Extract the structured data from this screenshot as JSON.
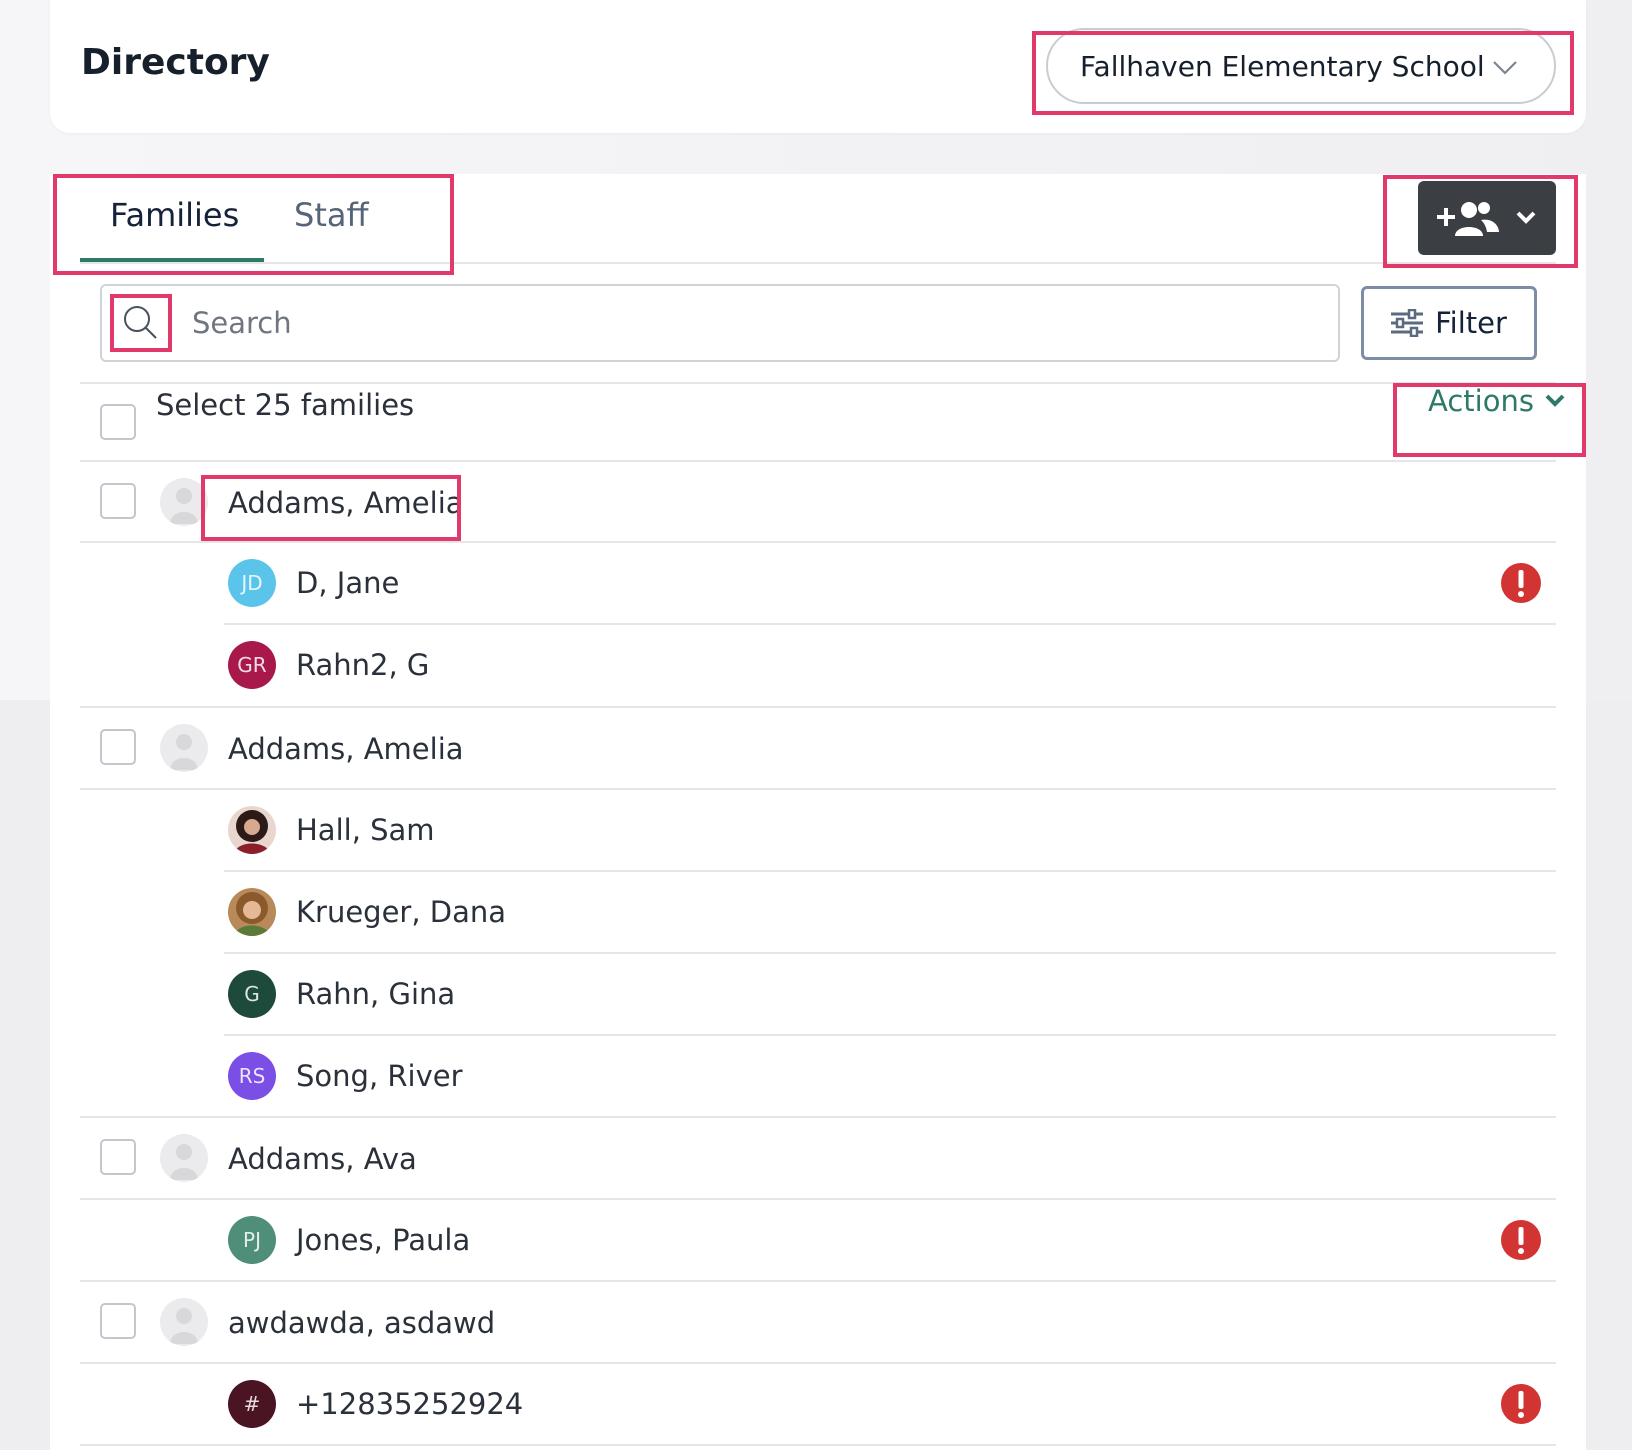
{
  "header": {
    "title": "Directory",
    "school_select": "Fallhaven Elementary School"
  },
  "tabs": [
    {
      "label": "Families",
      "active": true
    },
    {
      "label": "Staff",
      "active": false
    }
  ],
  "search": {
    "placeholder": "Search",
    "value": ""
  },
  "filter_label": "Filter",
  "select_all_label": "Select 25 families",
  "actions_label": "Actions",
  "colors": {
    "accent": "#2e7a68",
    "highlight": "#e0396a",
    "alert": "#d23434",
    "dark_button": "#3b3e42"
  },
  "families": [
    {
      "name": "Addams, Amelia",
      "members": [
        {
          "name": "D, Jane",
          "initials": "JD",
          "color": "#5bc4ea",
          "alert": true
        },
        {
          "name": "Rahn2, G",
          "initials": "GR",
          "color": "#a8184b",
          "alert": false
        }
      ]
    },
    {
      "name": "Addams, Amelia",
      "members": [
        {
          "name": "Hall, Sam",
          "initials": "",
          "color": "#6a3b35",
          "photo": true,
          "alert": false
        },
        {
          "name": "Krueger, Dana",
          "initials": "",
          "color": "#9b6b3a",
          "photo": true,
          "alert": false
        },
        {
          "name": "Rahn, Gina",
          "initials": "G",
          "color": "#1e4a3c",
          "alert": false
        },
        {
          "name": "Song, River",
          "initials": "RS",
          "color": "#7b4fe6",
          "alert": false
        }
      ]
    },
    {
      "name": "Addams, Ava",
      "members": [
        {
          "name": "Jones, Paula",
          "initials": "PJ",
          "color": "#4f8e78",
          "alert": true
        }
      ]
    },
    {
      "name": "awdawda, asdawd",
      "members": [
        {
          "name": "+12835252924",
          "initials": "#",
          "color": "#4a1423",
          "alert": true
        }
      ]
    }
  ]
}
